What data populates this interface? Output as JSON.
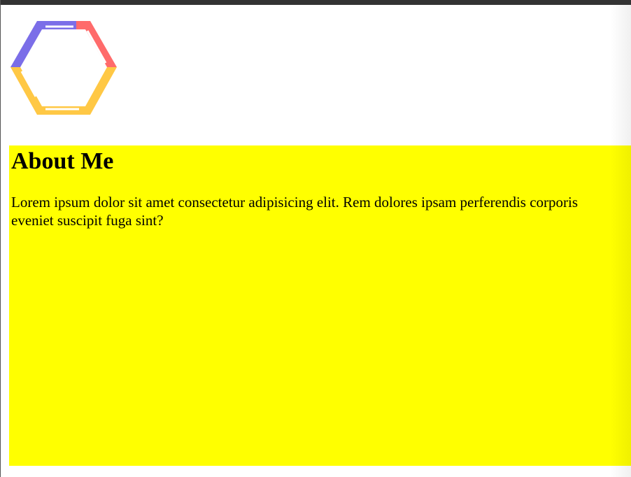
{
  "logo": {
    "icon": "hexagon-logo-icon",
    "colors": {
      "purple": "#7b6ee8",
      "red": "#ff6b6b",
      "yellow": "#ffc845"
    }
  },
  "about": {
    "heading": "About Me",
    "text": "Lorem ipsum dolor sit amet consectetur adipisicing elit. Rem dolores ipsam perferendis corporis eveniet suscipit fuga sint?",
    "background": "#ffff00"
  },
  "window": {
    "top_bar_color": "#333333"
  }
}
